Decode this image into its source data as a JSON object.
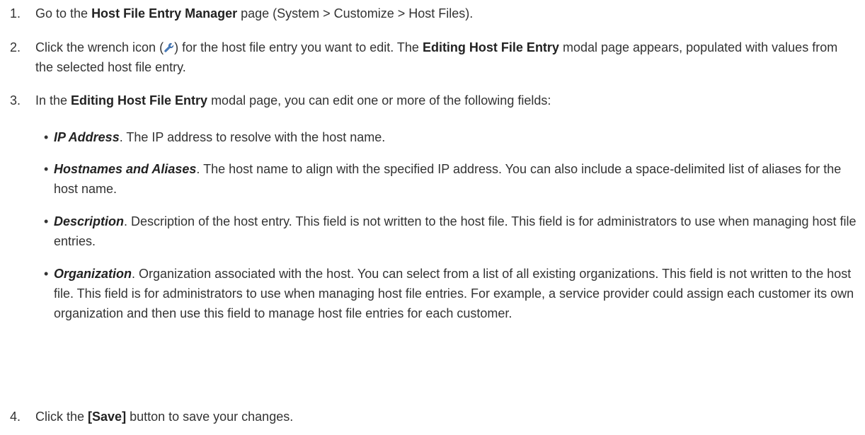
{
  "steps": [
    {
      "number": "1.",
      "pre": "Go to the ",
      "bold": "Host File Entry Manager",
      "post": " page (System > Customize > Host Files)."
    },
    {
      "number": "2.",
      "pre": "Click the wrench icon (",
      "icon": "wrench-icon",
      "mid": ") for the host file entry you want to edit. The ",
      "bold": "Editing Host File Entry",
      "post": " modal page appears, populated with values from the selected host file entry."
    },
    {
      "number": "3.",
      "pre": "In the ",
      "bold": "Editing Host File Entry",
      "post": " modal page, you can edit one or more of the following fields:"
    },
    {
      "number": "4.",
      "pre": "Click the ",
      "bold": "[Save]",
      "post": " button to save your changes."
    }
  ],
  "fields": [
    {
      "term": "IP Address",
      "text": ". The IP address to resolve with the host name."
    },
    {
      "term": "Hostnames and Aliases",
      "text": ". The host name to align with the specified IP address. You can also include a space-delimited list of aliases for the host name."
    },
    {
      "term": "Description",
      "text": ". Description of the host entry. This field is not written to the host file. This field is for administrators to use when managing host file entries."
    },
    {
      "term": "Organization",
      "text": ". Organization associated with the host. You can select from a list of all existing organizations. This field is not written to the host file. This field is for administrators to use when managing host file entries. For example, a service provider could assign each customer its own organization and then use this field to manage host file entries for each customer."
    }
  ],
  "colors": {
    "text": "#333333",
    "icon_blue": "#4a7fc1"
  }
}
